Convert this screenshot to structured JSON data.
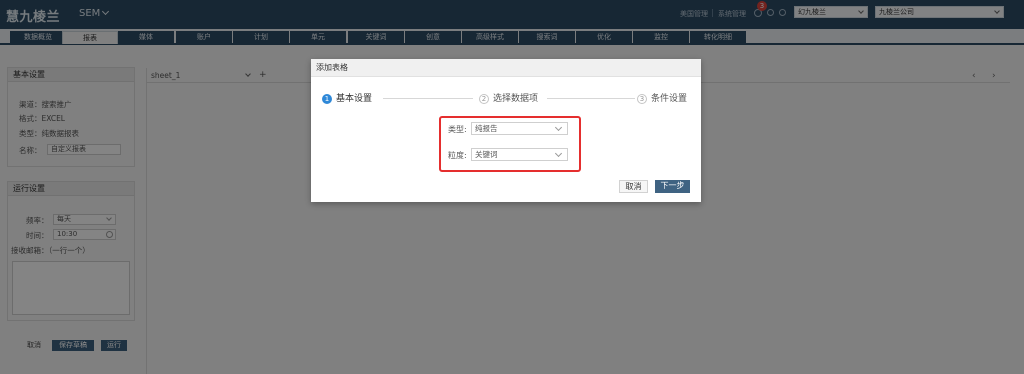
{
  "header": {
    "logo": "慧九棱兰",
    "product": "SEM",
    "links": [
      "美国管理",
      "系统管理"
    ],
    "notification_count": "3",
    "account_select": "幻九棱兰",
    "company_select": "九棱兰公司"
  },
  "tabs": [
    "数据概览",
    "报表",
    "媒体",
    "账户",
    "计划",
    "单元",
    "关键词",
    "创意",
    "高级样式",
    "搜索词",
    "优化",
    "监控",
    "转化明细"
  ],
  "sidebar": {
    "basic": {
      "title": "基本设置",
      "channel": "渠道：搜索推广",
      "format": "格式：EXCEL",
      "type": "类型：纯数据报表",
      "name_label": "名称：",
      "name_value": "自定义报表"
    },
    "run": {
      "title": "运行设置",
      "freq_label": "频率：",
      "freq_value": "每天",
      "time_label": "时间：",
      "time_value": "10:30",
      "email_label": "接收邮箱：（一行一个）"
    },
    "buttons": [
      "取消",
      "保存草稿",
      "运行"
    ]
  },
  "sheet": {
    "tab_label": "sheet_1",
    "add": "+",
    "prev": "‹",
    "next": "›"
  },
  "modal": {
    "title": "添加表格",
    "steps": [
      {
        "num": "1",
        "label": "基本设置"
      },
      {
        "num": "2",
        "label": "选择数据项"
      },
      {
        "num": "3",
        "label": "条件设置"
      }
    ],
    "type_label": "类型:",
    "type_value": "纯报告",
    "granularity_label": "粒度:",
    "granularity_value": "关键词",
    "cancel": "取消",
    "next": "下一步"
  },
  "colors": {
    "header_bg": "#2d4a63",
    "accent_blue": "#2f88d8",
    "highlight_red": "#e52e2e"
  }
}
